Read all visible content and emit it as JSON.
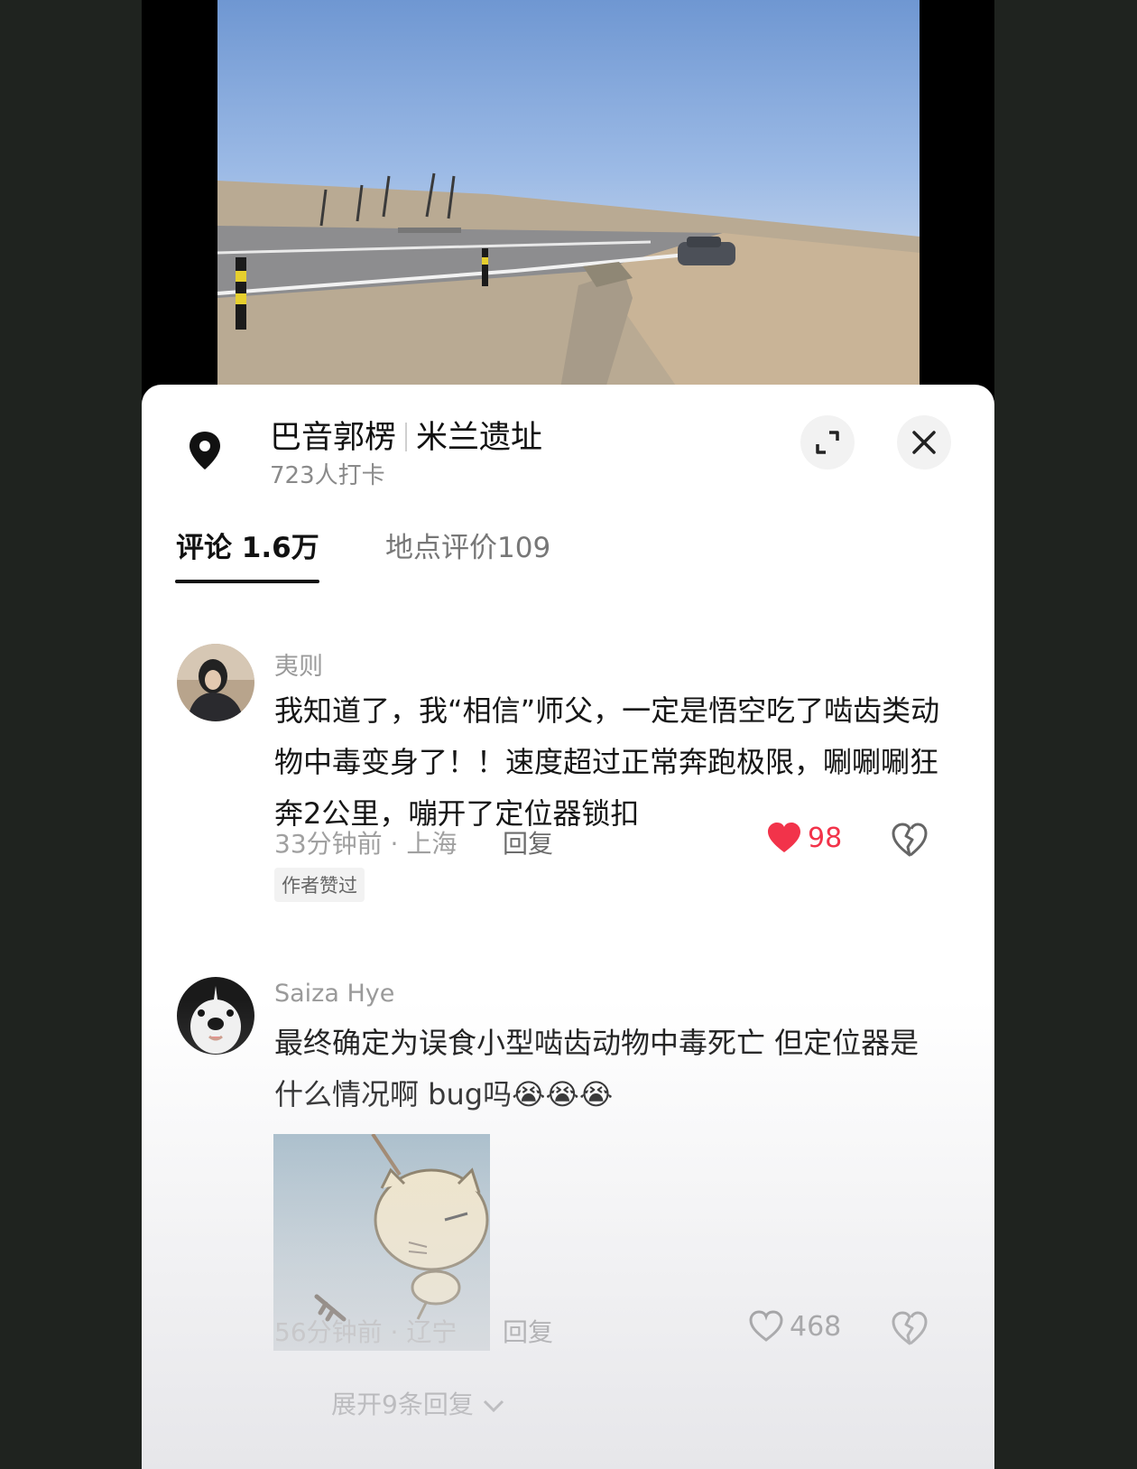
{
  "video": {
    "search_icon": "search-icon"
  },
  "location": {
    "region": "巴音郭楞",
    "place": "米兰遗址",
    "checkins": "723人打卡",
    "icon": "location-pin-icon"
  },
  "tabs": [
    {
      "label": "评论 1.6万",
      "active": true
    },
    {
      "label": "地点评价109",
      "active": false
    }
  ],
  "comments": [
    {
      "author": "夷则",
      "text": "我知道了，我“相信”师父，一定是悟空吃了啮齿类动物中毒变身了！！速度超过正常奔跑极限，唰唰唰狂奔2公里，嘣开了定位器锁扣",
      "meta": "33分钟前 · 上海",
      "reply_label": "回复",
      "likes": "98",
      "liked": true,
      "badge": "作者赞过"
    },
    {
      "author": "Saiza Hye",
      "text": "最终确定为误食小型啮齿动物中毒死亡 但定位器是什么情况啊 bug吗😭😭😭",
      "meta": "56分钟前 · 辽宁",
      "reply_label": "回复",
      "likes": "468",
      "liked": false,
      "expand_replies": "展开9条回复"
    }
  ],
  "colors": {
    "like_active": "#f2334a",
    "text": "#161616",
    "muted": "#9a9a9a"
  }
}
